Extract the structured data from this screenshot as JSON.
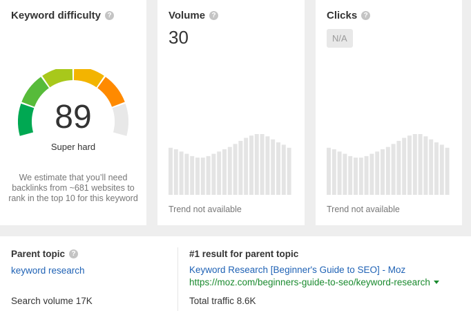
{
  "keyword_difficulty": {
    "title": "Keyword difficulty",
    "value": "89",
    "label": "Super hard",
    "note": "We estimate that you’ll need backlinks from ~681 websites to rank in the top 10 for this keyword",
    "gauge_level": 0.89
  },
  "volume": {
    "title": "Volume",
    "value": "30",
    "trend_note": "Trend not available"
  },
  "clicks": {
    "title": "Clicks",
    "value": "N/A",
    "trend_note": "Trend not available"
  },
  "trend_placeholder_heights": [
    0.62,
    0.6,
    0.57,
    0.54,
    0.51,
    0.49,
    0.49,
    0.51,
    0.54,
    0.57,
    0.6,
    0.63,
    0.67,
    0.71,
    0.75,
    0.78,
    0.8,
    0.8,
    0.77,
    0.73,
    0.69,
    0.66,
    0.62
  ],
  "parent_topic": {
    "title": "Parent topic",
    "link": "keyword research",
    "search_volume": "Search volume 17K"
  },
  "top_result": {
    "title": "#1 result for parent topic",
    "page_title": "Keyword Research [Beginner's Guide to SEO] - Moz",
    "url": "https://moz.com/beginners-guide-to-seo/keyword-research",
    "total_traffic": "Total traffic 8.6K"
  },
  "colors": {
    "gauge_segments": [
      "#00a852",
      "#57bb3a",
      "#a8c81b",
      "#f3b400",
      "#ff8a00",
      "#e8e8e8"
    ],
    "trend_bar": "#e4e4e4",
    "link": "#1f62b5",
    "url": "#1a8a2e"
  }
}
